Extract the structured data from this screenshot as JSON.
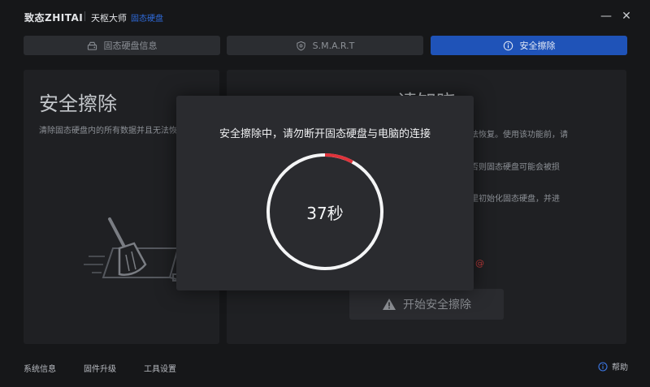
{
  "titlebar": {
    "logo": "致态ZHITAI",
    "app_name": "天枢大师",
    "app_sub": "固态硬盘",
    "minimize_glyph": "—",
    "close_glyph": "✕"
  },
  "tabs": [
    {
      "label": "固态硬盘信息",
      "icon": "drive-icon",
      "active": false
    },
    {
      "label": "S.M.A.R.T",
      "icon": "shield-icon",
      "active": false
    },
    {
      "label": "安全擦除",
      "icon": "info-icon",
      "active": true
    }
  ],
  "left_panel": {
    "title": "安全擦除",
    "description": "清除固态硬盘内的所有数据并且无法恢",
    "illustration": "broom-icon"
  },
  "right_panel": {
    "title": "请知晓",
    "lines": [
      "法恢复。使用该功能前，请",
      "否则固态硬盘可能会被损",
      "】里初始化固态硬盘，并进"
    ],
    "warning_glyph": "@",
    "start_button": "开始安全擦除"
  },
  "modal": {
    "message": "安全擦除中，请勿断开固态硬盘与电脑的连接",
    "countdown": "37秒",
    "progress_fraction": 0.08,
    "progress_color": "#e0333b",
    "track_color": "#f4f5f6"
  },
  "footer": {
    "links": [
      "系统信息",
      "固件升级",
      "工具设置"
    ],
    "help": "帮助"
  },
  "colors": {
    "accent": "#1f53b8",
    "background": "#161719",
    "panel": "#1f2023",
    "modal": "#2a2b2f"
  }
}
